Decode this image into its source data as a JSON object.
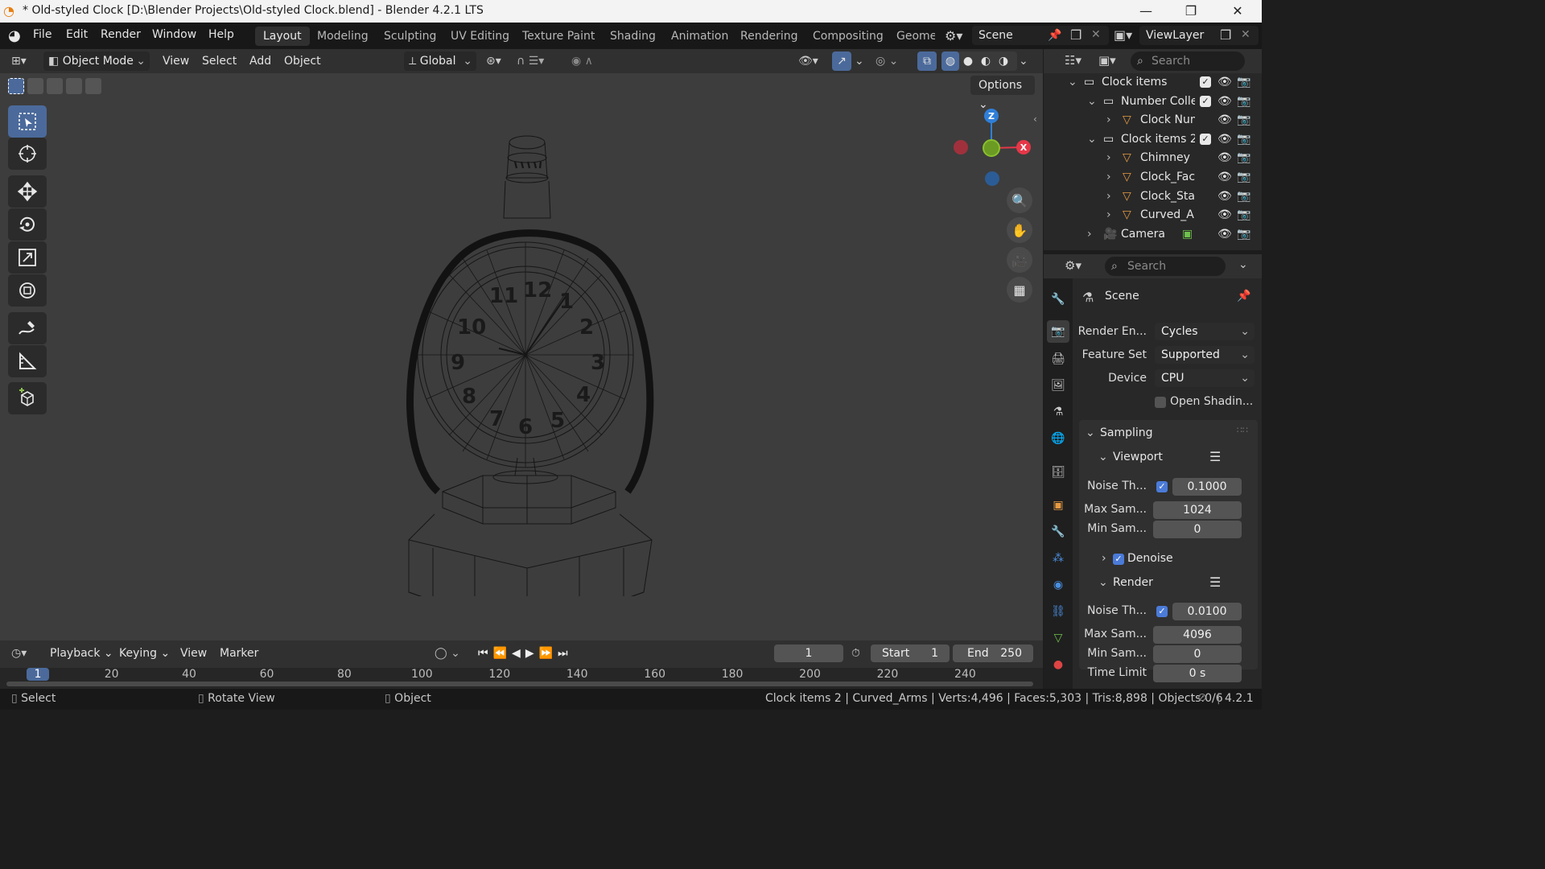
{
  "window": {
    "title": "* Old-styled Clock [D:\\Blender Projects\\Old-styled Clock.blend] - Blender 4.2.1 LTS",
    "minimize": "—",
    "maximize": "❐",
    "close": "✕"
  },
  "menu": [
    "File",
    "Edit",
    "Render",
    "Window",
    "Help"
  ],
  "workspaces": [
    "Layout",
    "Modeling",
    "Sculpting",
    "UV Editing",
    "Texture Paint",
    "Shading",
    "Animation",
    "Rendering",
    "Compositing",
    "Geome"
  ],
  "active_workspace": "Layout",
  "scene_name": "Scene",
  "view_layer": "ViewLayer",
  "viewport": {
    "mode": "Object Mode",
    "menus": [
      "View",
      "Select",
      "Add",
      "Object"
    ],
    "transform_orientation": "Global",
    "options_label": "Options",
    "shading": "wireframe",
    "axes": {
      "z": "Z",
      "x": "X"
    }
  },
  "outliner": {
    "search_placeholder": "Search",
    "items": [
      {
        "label": "Clock items",
        "type": "collection",
        "depth": 0,
        "expanded": true,
        "checked": true
      },
      {
        "label": "Number Colle",
        "type": "collection",
        "depth": 1,
        "expanded": true,
        "checked": true
      },
      {
        "label": "Clock Num",
        "type": "mesh",
        "depth": 2,
        "expanded": false
      },
      {
        "label": "Clock items 2",
        "type": "collection",
        "depth": 1,
        "expanded": true,
        "checked": true
      },
      {
        "label": "Chimney",
        "type": "mesh",
        "depth": 2,
        "expanded": false
      },
      {
        "label": "Clock_Fac",
        "type": "mesh",
        "depth": 2,
        "expanded": false
      },
      {
        "label": "Clock_Star",
        "type": "mesh",
        "depth": 2,
        "expanded": false
      },
      {
        "label": "Curved_Ar",
        "type": "mesh",
        "depth": 2,
        "expanded": false
      },
      {
        "label": "Camera",
        "type": "camera",
        "depth": 1,
        "expanded": false
      }
    ]
  },
  "properties": {
    "search_placeholder": "Search",
    "context": "Scene",
    "render_engine_label": "Render En...",
    "render_engine": "Cycles",
    "feature_set_label": "Feature Set",
    "feature_set": "Supported",
    "device_label": "Device",
    "device": "CPU",
    "open_shading_label": "Open Shadin...",
    "sampling_label": "Sampling",
    "viewport_label": "Viewport",
    "vp_noise_label": "Noise Th...",
    "vp_noise": "0.1000",
    "vp_max_label": "Max Sam...",
    "vp_max": "1024",
    "vp_min_label": "Min Sam...",
    "vp_min": "0",
    "denoise_label": "Denoise",
    "render_label": "Render",
    "r_noise_label": "Noise Th...",
    "r_noise": "0.0100",
    "r_max_label": "Max Sam...",
    "r_max": "4096",
    "r_min_label": "Min Sam...",
    "r_min": "0",
    "time_limit_label": "Time Limit",
    "time_limit": "0 s"
  },
  "timeline": {
    "menus": [
      "Playback",
      "Keying",
      "View",
      "Marker"
    ],
    "current_frame": "1",
    "start_label": "Start",
    "start": "1",
    "end_label": "End",
    "end": "250",
    "ruler": [
      "1",
      "20",
      "40",
      "60",
      "80",
      "100",
      "120",
      "140",
      "160",
      "180",
      "200",
      "220",
      "240"
    ]
  },
  "status": {
    "select": "Select",
    "rotate": "Rotate View",
    "object": "Object",
    "info": "Clock items 2 | Curved_Arms | Verts:4,496 | Faces:5,303 | Tris:8,898 | Objects:0/6",
    "version": "4.2.1"
  },
  "colors": {
    "accent": "#4b6a9b",
    "x_axis": "#e53748",
    "y_axis": "#89c02e",
    "z_axis": "#2f7fd8",
    "mesh_icon": "#e59a43"
  }
}
